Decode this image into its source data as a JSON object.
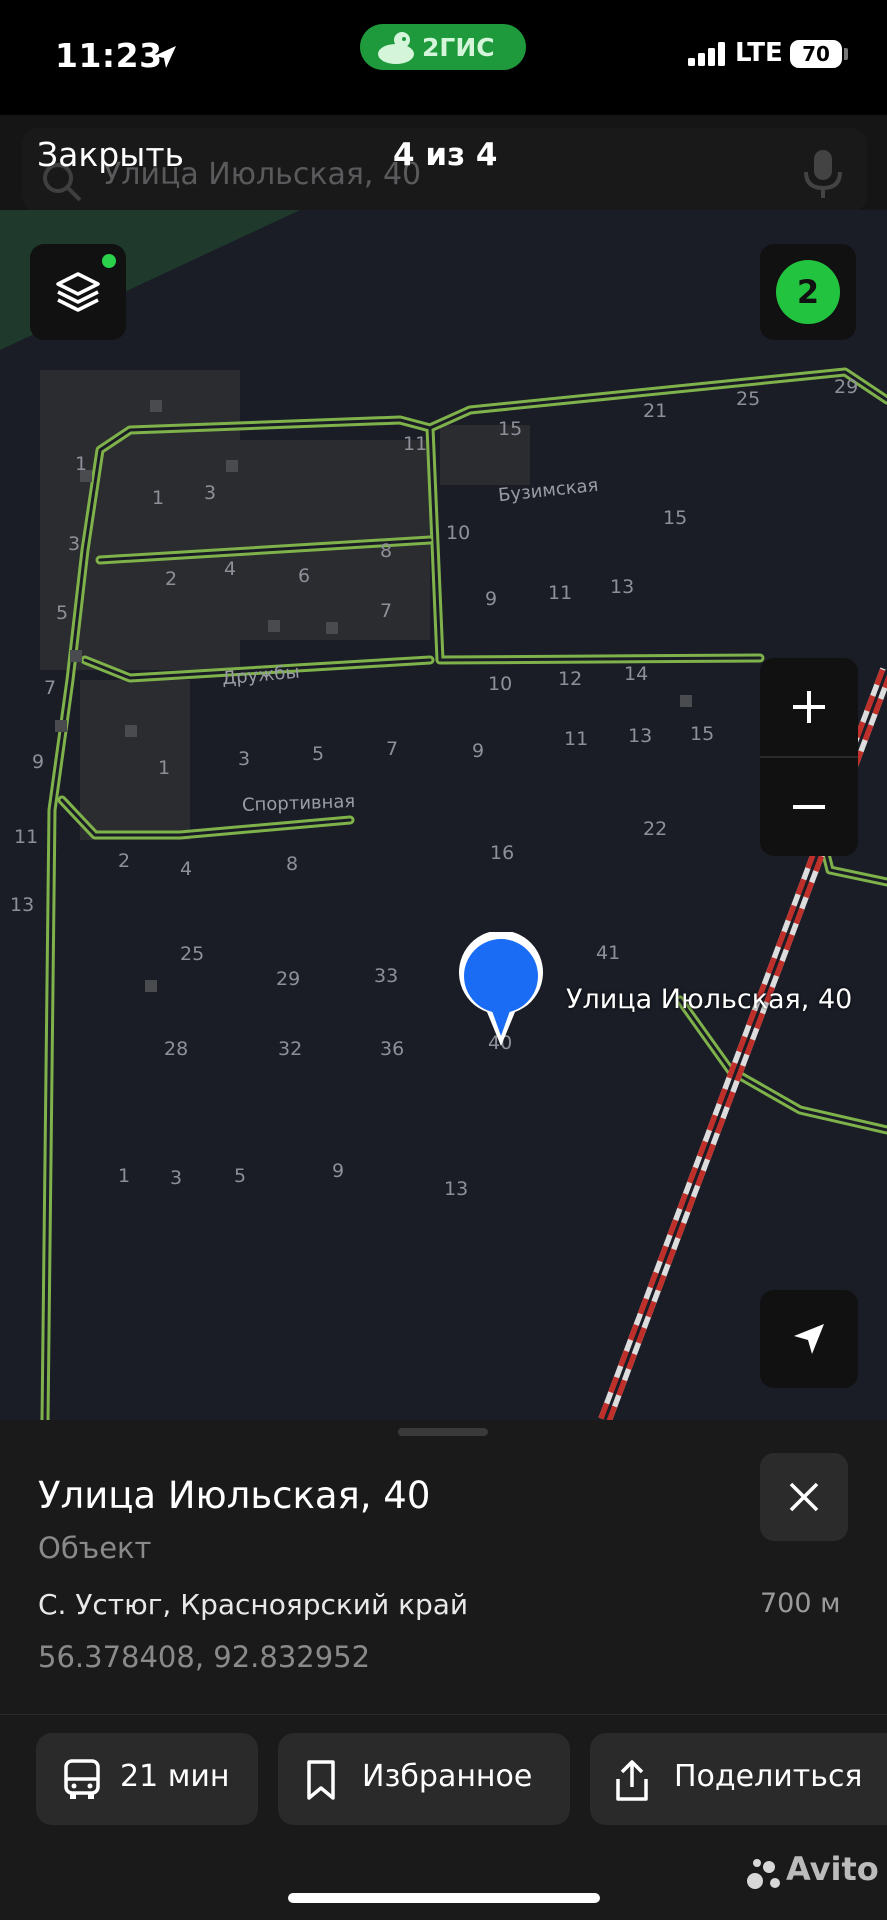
{
  "status_bar": {
    "time": "11:23",
    "app_name": "2ГИС",
    "network": "LTE",
    "battery": "70"
  },
  "top_bar": {
    "close_label": "Закрыть",
    "counter": "4 из 4",
    "search_value": "Улица Июльская, 40"
  },
  "map": {
    "streets": [
      "Бузимская",
      "Дружбы",
      "Спортивная"
    ],
    "house_numbers": [
      "1",
      "1",
      "3",
      "3",
      "5",
      "7",
      "9",
      "11",
      "13",
      "2",
      "4",
      "6",
      "8",
      "7",
      "11",
      "15",
      "21",
      "25",
      "29",
      "10",
      "15",
      "9",
      "11",
      "13",
      "10",
      "12",
      "14",
      "11",
      "13",
      "15",
      "1",
      "3",
      "5",
      "7",
      "9",
      "22",
      "16",
      "2",
      "4",
      "8",
      "25",
      "29",
      "33",
      "41",
      "28",
      "32",
      "36",
      "40",
      "1",
      "3",
      "5",
      "9",
      "13"
    ],
    "layers_button": "layers-icon",
    "badge_count": "2",
    "zoom_in": "+",
    "zoom_out": "−",
    "pin_label": "Улица Июльская, 40"
  },
  "place_card": {
    "title": "Улица Июльская, 40",
    "type": "Объект",
    "address": "С. Устюг, Красноярский край",
    "distance": "700 м",
    "coordinates": "56.378408, 92.832952"
  },
  "actions": [
    {
      "icon": "bus-icon",
      "label": "21 мин"
    },
    {
      "icon": "bookmark-icon",
      "label": "Избранное"
    },
    {
      "icon": "share-icon",
      "label": "Поделиться"
    }
  ],
  "watermark": "Avito",
  "colors": {
    "road": "#7fb24a",
    "pin": "#1a6cf5",
    "badge": "#22c43f",
    "rail_red": "#c0302b"
  }
}
